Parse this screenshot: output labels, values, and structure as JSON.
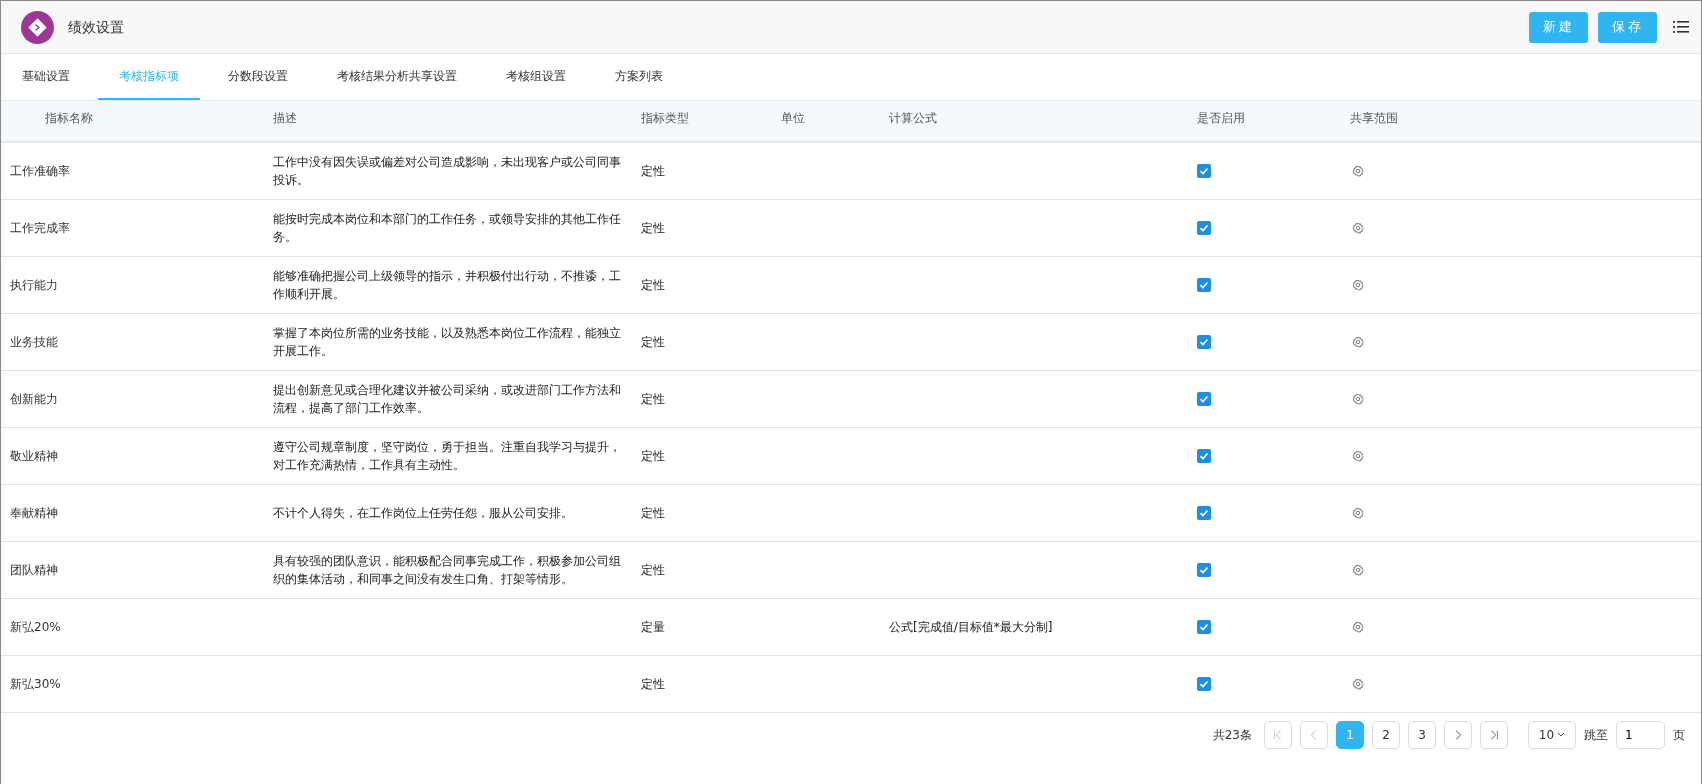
{
  "header": {
    "title": "绩效设置",
    "buttons": [
      "新建",
      "保存"
    ]
  },
  "tabs": [
    {
      "label": "基础设置",
      "selected": false
    },
    {
      "label": "考核指标项",
      "selected": true
    },
    {
      "label": "分数段设置",
      "selected": false
    },
    {
      "label": "考核结果分析共享设置",
      "selected": false
    },
    {
      "label": "考核组设置",
      "selected": false
    },
    {
      "label": "方案列表",
      "selected": false
    }
  ],
  "table": {
    "columns": [
      "指标名称",
      "描述",
      "指标类型",
      "单位",
      "计算公式",
      "是否启用",
      "共享范围"
    ],
    "rows": [
      {
        "name": "工作准确率",
        "description": "工作中没有因失误或偏差对公司造成影响，未出现客户或公司同事投诉。",
        "type": "定性",
        "enabled": true
      },
      {
        "name": "工作完成率",
        "description": "能按时完成本岗位和本部门的工作任务，或领导安排的其他工作任务。",
        "type": "定性",
        "enabled": true
      },
      {
        "name": "执行能力",
        "description": "能够准确把握公司上级领导的指示，并积极付出行动，不推诿，工作顺利开展。",
        "type": "定性",
        "enabled": true
      },
      {
        "name": "业务技能",
        "description": "掌握了本岗位所需的业务技能，以及熟悉本岗位工作流程，能独立开展工作。",
        "type": "定性",
        "enabled": true
      },
      {
        "name": "创新能力",
        "description": "提出创新意见或合理化建议并被公司采纳，或改进部门工作方法和流程，提高了部门工作效率。",
        "type": "定性",
        "enabled": true
      },
      {
        "name": "敬业精神",
        "description": "遵守公司规章制度，坚守岗位，勇于担当。注重自我学习与提升，对工作充满热情，工作具有主动性。",
        "type": "定性",
        "enabled": true
      },
      {
        "name": "奉献精神",
        "description": "不计个人得失，在工作岗位上任劳任怨，服从公司安排。",
        "type": "定性",
        "enabled": true
      },
      {
        "name": "团队精神",
        "description": "具有较强的团队意识，能积极配合同事完成工作，积极参加公司组织的集体活动，和同事之间没有发生口角、打架等情形。",
        "type": "定性",
        "enabled": true
      },
      {
        "name": "新弘20%",
        "type": "定量",
        "formula": "公式[完成值/目标值*最大分制]",
        "enabled": true
      },
      {
        "name": "新弘30%",
        "type": "定性",
        "enabled": true
      }
    ]
  },
  "pagination": {
    "total": "共23条",
    "nav_before": [
      {
        "kind": "first",
        "disabled": true
      },
      {
        "kind": "prev",
        "disabled": true
      }
    ],
    "pages": [
      {
        "label": "1",
        "selected": true
      },
      {
        "label": "2",
        "selected": false
      },
      {
        "label": "3",
        "selected": false
      }
    ],
    "nav_after": [
      {
        "kind": "next",
        "disabled": false
      },
      {
        "kind": "last",
        "disabled": false
      }
    ],
    "page_size": "10",
    "jump_label": "跳至",
    "jump_value": "1",
    "page_unit": "页"
  }
}
